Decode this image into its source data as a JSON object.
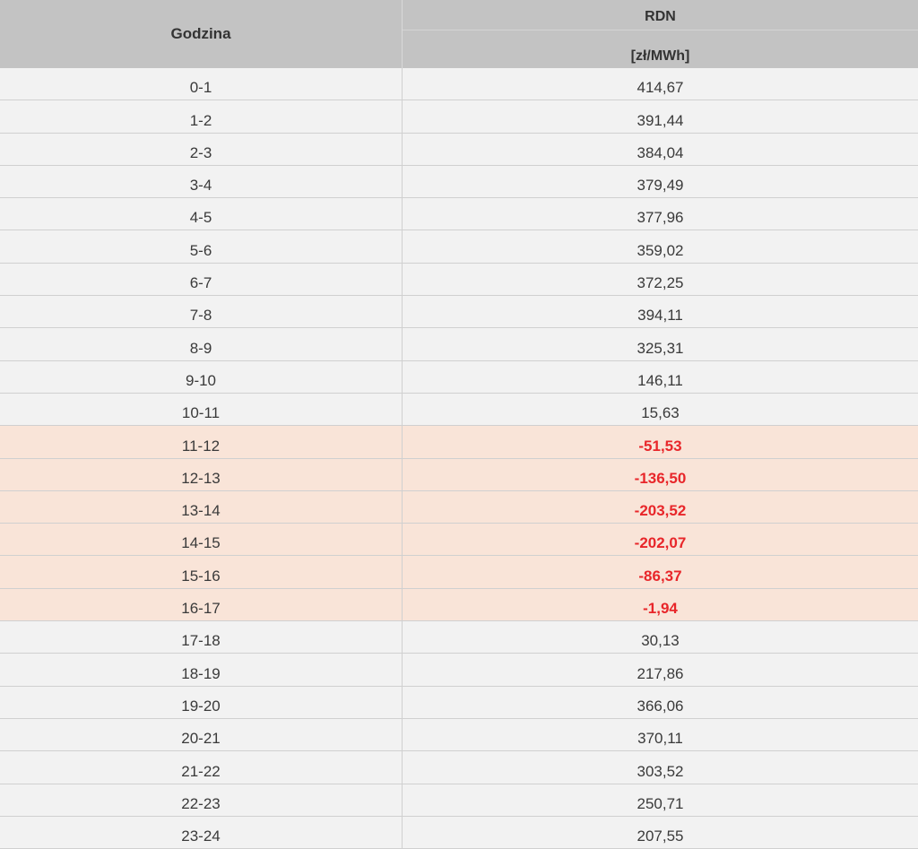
{
  "header": {
    "hour_label": "Godzina",
    "market_label": "RDN",
    "unit_label": "[zł/MWh]"
  },
  "colors": {
    "header_bg": "#c3c3c3",
    "row_bg": "#f2f2f2",
    "negative_row_bg": "#f9e4d8",
    "negative_text": "#e8262a"
  },
  "rows": [
    {
      "hour": "0-1",
      "price": "414,67",
      "negative": false
    },
    {
      "hour": "1-2",
      "price": "391,44",
      "negative": false
    },
    {
      "hour": "2-3",
      "price": "384,04",
      "negative": false
    },
    {
      "hour": "3-4",
      "price": "379,49",
      "negative": false
    },
    {
      "hour": "4-5",
      "price": "377,96",
      "negative": false
    },
    {
      "hour": "5-6",
      "price": "359,02",
      "negative": false
    },
    {
      "hour": "6-7",
      "price": "372,25",
      "negative": false
    },
    {
      "hour": "7-8",
      "price": "394,11",
      "negative": false
    },
    {
      "hour": "8-9",
      "price": "325,31",
      "negative": false
    },
    {
      "hour": "9-10",
      "price": "146,11",
      "negative": false
    },
    {
      "hour": "10-11",
      "price": "15,63",
      "negative": false
    },
    {
      "hour": "11-12",
      "price": "-51,53",
      "negative": true
    },
    {
      "hour": "12-13",
      "price": "-136,50",
      "negative": true
    },
    {
      "hour": "13-14",
      "price": "-203,52",
      "negative": true
    },
    {
      "hour": "14-15",
      "price": "-202,07",
      "negative": true
    },
    {
      "hour": "15-16",
      "price": "-86,37",
      "negative": true
    },
    {
      "hour": "16-17",
      "price": "-1,94",
      "negative": true
    },
    {
      "hour": "17-18",
      "price": "30,13",
      "negative": false
    },
    {
      "hour": "18-19",
      "price": "217,86",
      "negative": false
    },
    {
      "hour": "19-20",
      "price": "366,06",
      "negative": false
    },
    {
      "hour": "20-21",
      "price": "370,11",
      "negative": false
    },
    {
      "hour": "21-22",
      "price": "303,52",
      "negative": false
    },
    {
      "hour": "22-23",
      "price": "250,71",
      "negative": false
    },
    {
      "hour": "23-24",
      "price": "207,55",
      "negative": false
    }
  ]
}
